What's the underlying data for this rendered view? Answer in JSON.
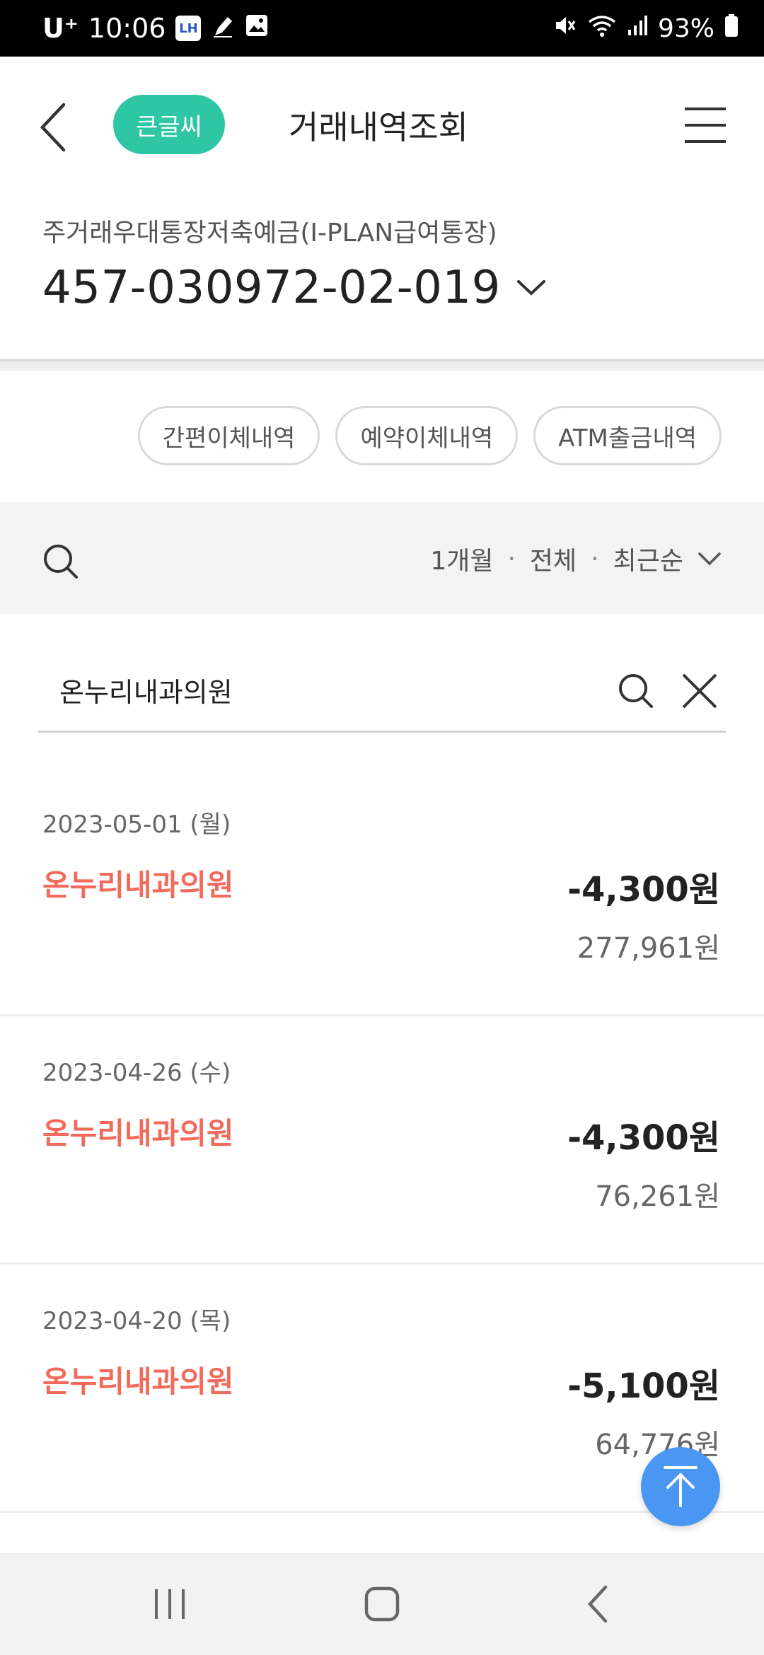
{
  "status_bar": {
    "carrier": "U⁺",
    "time": "10:06",
    "lh_badge": "LH",
    "battery": "93%",
    "icons": [
      "lh-app-icon",
      "pen-icon",
      "image-icon",
      "mute-icon",
      "wifi-icon",
      "signal-icon",
      "battery-icon"
    ]
  },
  "header": {
    "big_text_label": "큰글씨",
    "title": "거래내역조회"
  },
  "account": {
    "type": "주거래우대통장저축예금(I-PLAN급여통장)",
    "number": "457-030972-02-019"
  },
  "chips": [
    "간편이체내역",
    "예약이체내역",
    "ATM출금내역"
  ],
  "filter": {
    "period": "1개월",
    "separator": "·",
    "kind": "전체",
    "order": "최근순"
  },
  "search": {
    "query": "온누리내과의원"
  },
  "transactions": [
    {
      "date": "2023-05-01 (월)",
      "name": "온누리내과의원",
      "amount": "-4,300원",
      "balance": "277,961원"
    },
    {
      "date": "2023-04-26 (수)",
      "name": "온누리내과의원",
      "amount": "-4,300원",
      "balance": "76,261원"
    },
    {
      "date": "2023-04-20 (목)",
      "name": "온누리내과의원",
      "amount": "-5,100원",
      "balance": "64,776원"
    }
  ],
  "colors": {
    "accent_green": "#2ec6a4",
    "tx_name_red": "#f26a5c",
    "fab_blue": "#4a96f3"
  }
}
